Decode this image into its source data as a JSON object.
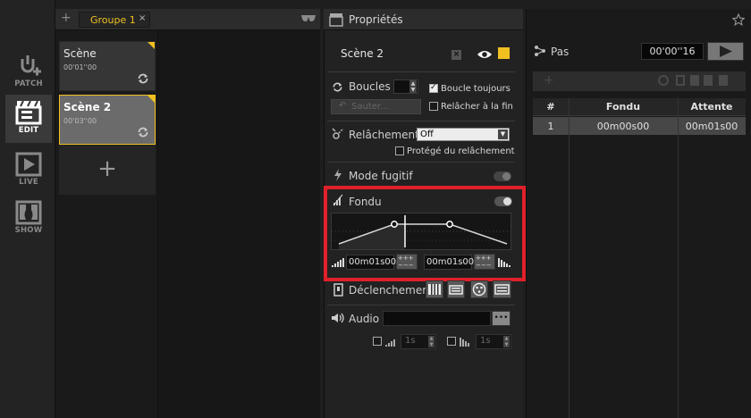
{
  "modebar": {
    "items": [
      {
        "label": "PATCH",
        "active": false
      },
      {
        "label": "EDIT",
        "active": true
      },
      {
        "label": "LIVE",
        "active": false
      },
      {
        "label": "SHOW",
        "active": false
      }
    ]
  },
  "scenes": {
    "add_tab_symbol": "+",
    "group_tab": "Groupe 1",
    "group_close": "×",
    "items": [
      {
        "name": "Scène",
        "time": "00'01''00",
        "selected": false
      },
      {
        "name": "Scène 2",
        "time": "00'03''00",
        "selected": true
      }
    ],
    "add_scene_symbol": "+"
  },
  "properties": {
    "title": "Propriétés",
    "scene_name": "Scène 2",
    "accent_color": "#f0c020",
    "loops": {
      "label": "Boucles",
      "value": "",
      "loop_always_label": "Boucle toujours",
      "loop_always_checked": true,
      "skip_button": "Sauter...",
      "release_at_end_label": "Relâcher à la fin",
      "release_at_end_checked": false
    },
    "release": {
      "label": "Relâchement",
      "selected": "Off",
      "protected_label": "Protégé du relâchement",
      "protected_checked": false
    },
    "fugitive": {
      "label": "Mode fugitif",
      "enabled": false
    },
    "fade": {
      "label": "Fondu",
      "enabled": true,
      "fade_in": "00m01s00",
      "fade_out": "00m01s00",
      "highlight_color": "#e0202a"
    },
    "trigger": {
      "label": "Déclenchemer"
    },
    "audio": {
      "label": "Audio",
      "file": "",
      "browse_button": "•••",
      "fade_in_value": "1s",
      "fade_out_value": "1s",
      "fade_in_checked": false,
      "fade_out_checked": false
    }
  },
  "steps": {
    "title": "Pas",
    "time": "00'00''16",
    "add_symbol": "+",
    "columns": [
      "#",
      "Fondu",
      "Attente"
    ],
    "rows": [
      {
        "num": "1",
        "fade": "00m00s00",
        "wait": "00m01s00"
      }
    ]
  }
}
